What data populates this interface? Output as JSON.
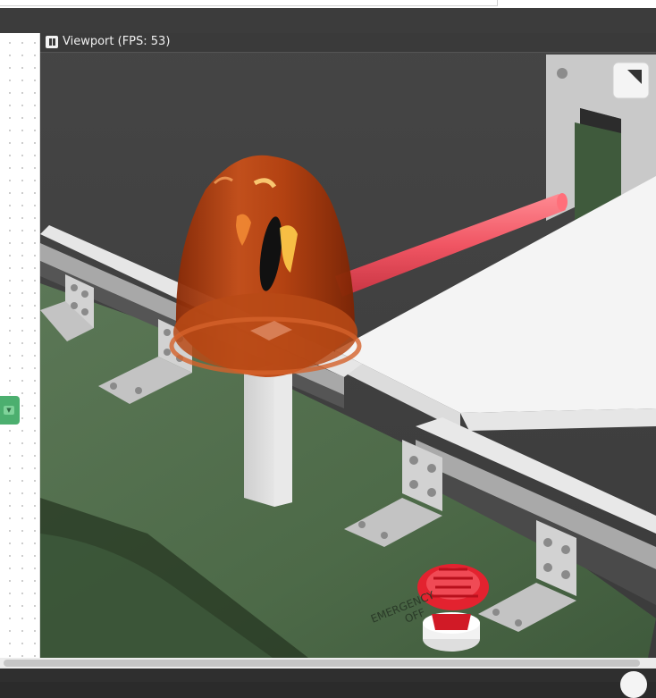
{
  "viewport": {
    "title": "Viewport (FPS: 53)",
    "pause_icon": "pause-icon",
    "fullscreen_icon": "expand-icon"
  },
  "scene": {
    "button_label_line1": "EMERGENCY",
    "button_label_line2": "OFF"
  },
  "colors": {
    "beacon": "#c24a12",
    "laser": "#f05a66",
    "belt": "#4f6b4a",
    "emergency_button": "#e2212f"
  }
}
